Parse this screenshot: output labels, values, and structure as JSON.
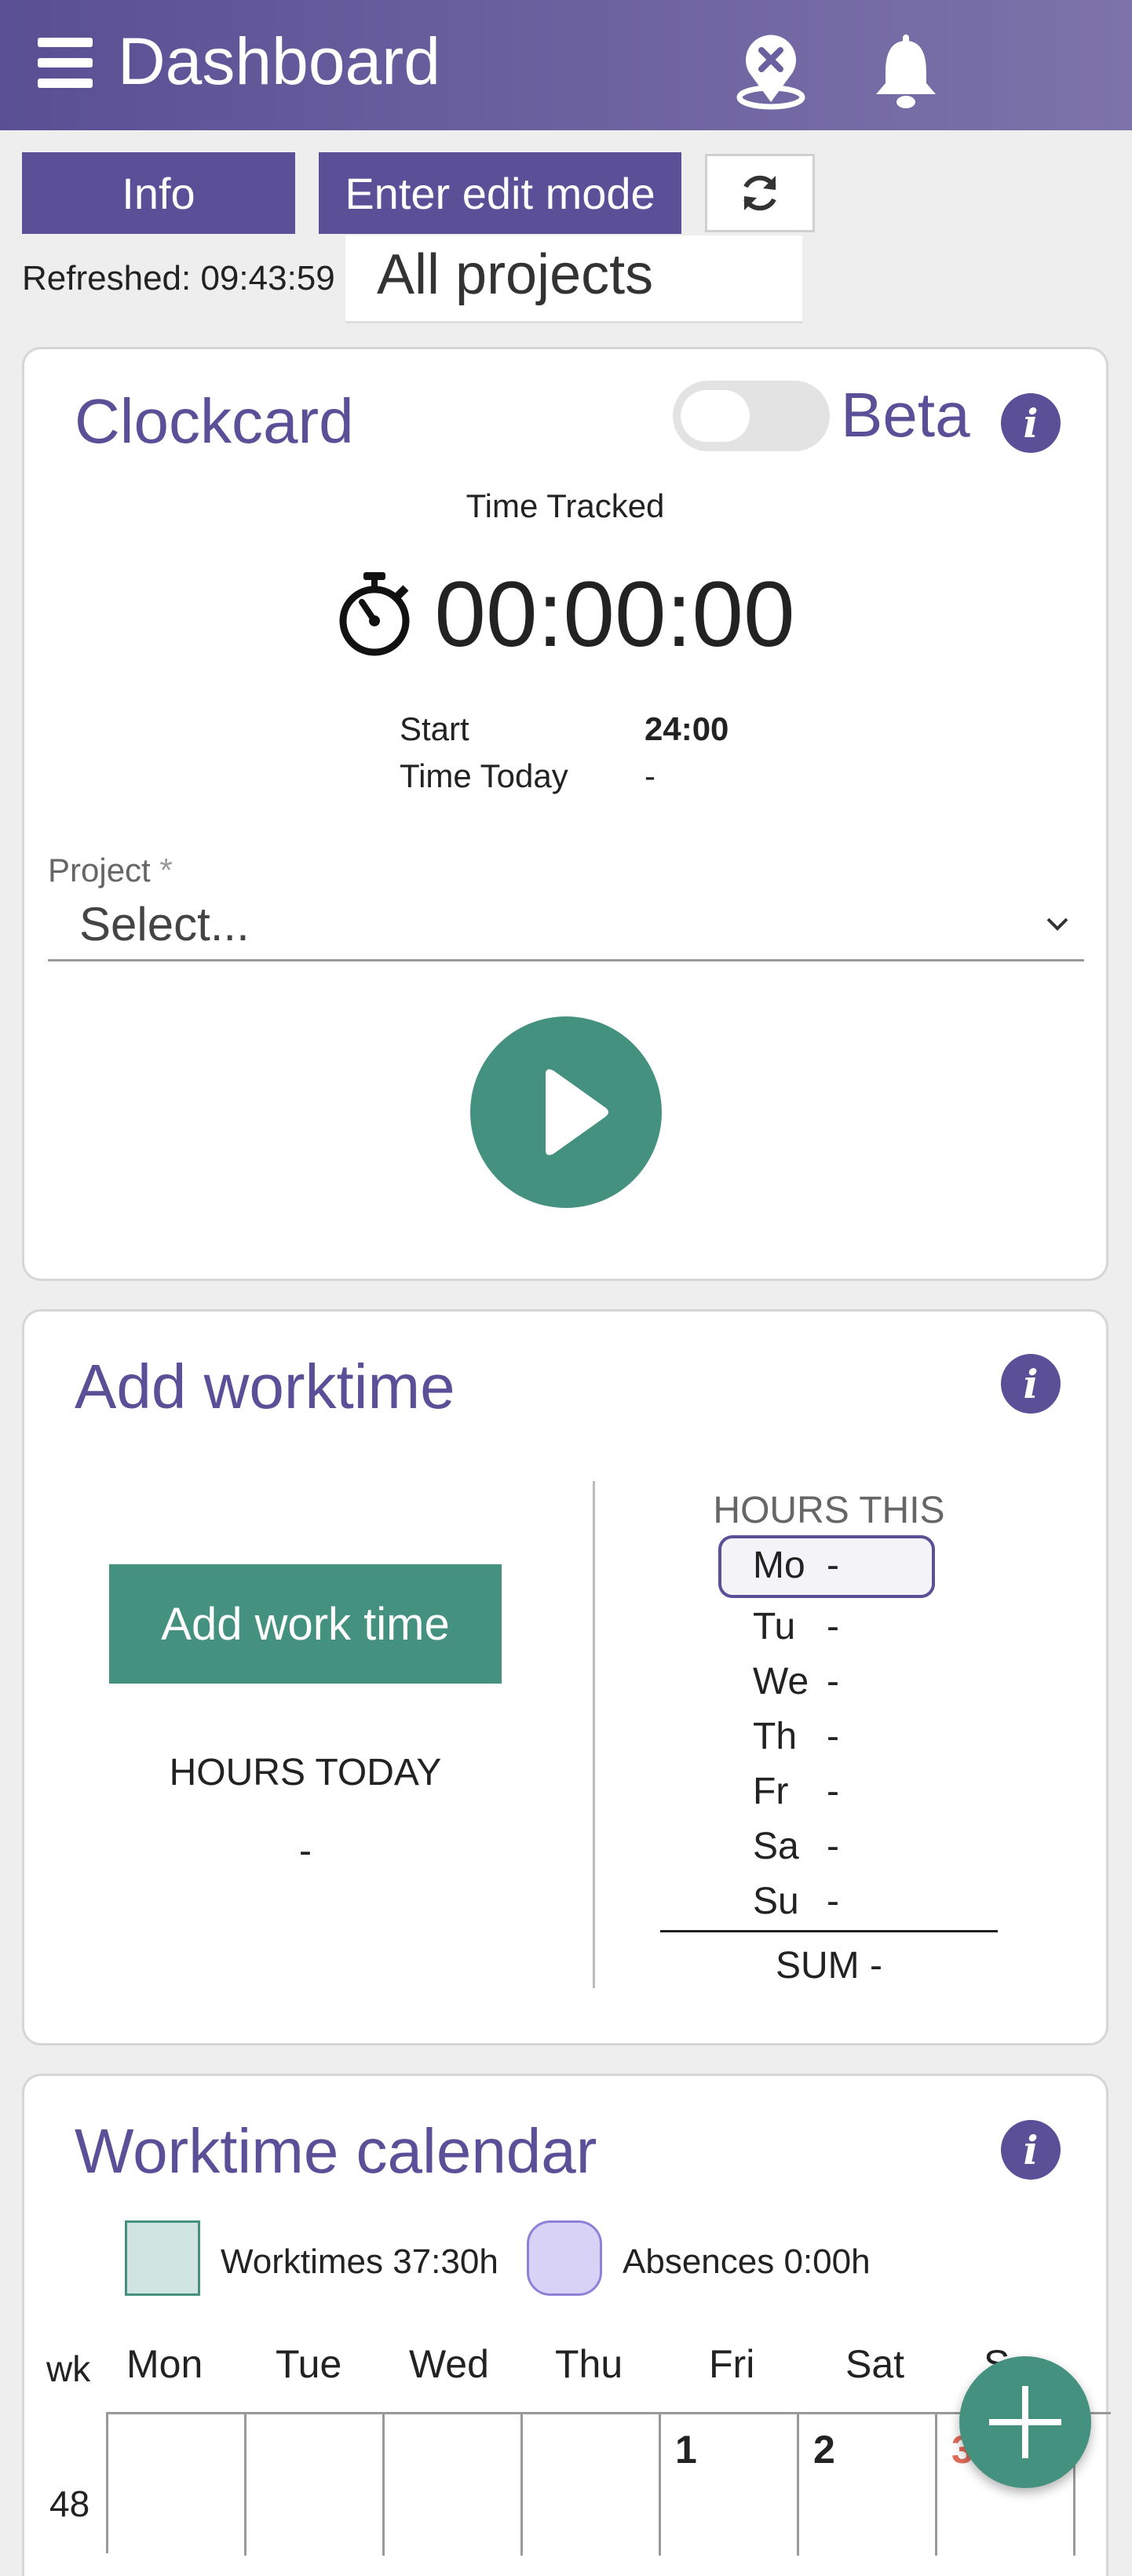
{
  "header": {
    "title": "Dashboard"
  },
  "toolbar": {
    "info_label": "Info",
    "edit_mode_label": "Enter edit mode",
    "refreshed_text": "Refreshed: 09:43:59",
    "project_filter": "All projects"
  },
  "clockcard": {
    "title": "Clockcard",
    "beta_label": "Beta",
    "beta_enabled": false,
    "time_tracked_label": "Time Tracked",
    "timer": "00:00:00",
    "start_label": "Start",
    "start_value": "24:00",
    "time_today_label": "Time Today",
    "time_today_value": "-",
    "project_label": "Project",
    "project_required_mark": "*",
    "project_placeholder": "Select..."
  },
  "add_worktime": {
    "title": "Add worktime",
    "button_label": "Add work time",
    "hours_today_label": "HOURS TODAY",
    "hours_today_value": "-",
    "week_title": "HOURS THIS WEEK",
    "days": [
      {
        "day": "Mo",
        "value": "-"
      },
      {
        "day": "Tu",
        "value": "-"
      },
      {
        "day": "We",
        "value": "-"
      },
      {
        "day": "Th",
        "value": "-"
      },
      {
        "day": "Fr",
        "value": "-"
      },
      {
        "day": "Sa",
        "value": "-"
      },
      {
        "day": "Su",
        "value": "-"
      }
    ],
    "sum_text": "SUM -"
  },
  "calendar": {
    "title": "Worktime calendar",
    "legend_worktimes": "Worktimes 37:30h",
    "legend_absences": "Absences 0:00h",
    "wk_label": "wk",
    "day_headers": [
      "Mon",
      "Tue",
      "Wed",
      "Thu",
      "Fri",
      "Sat",
      "S"
    ],
    "week_number": "48",
    "dates": [
      "",
      "",
      "",
      "",
      "1",
      "2",
      "3"
    ]
  },
  "colors": {
    "brand_purple": "#5b4f98",
    "green": "#45917f",
    "worktime_legend": "#d1e5e0",
    "absence_legend": "#d9d2f7",
    "sunday_red": "#e06c5b"
  }
}
